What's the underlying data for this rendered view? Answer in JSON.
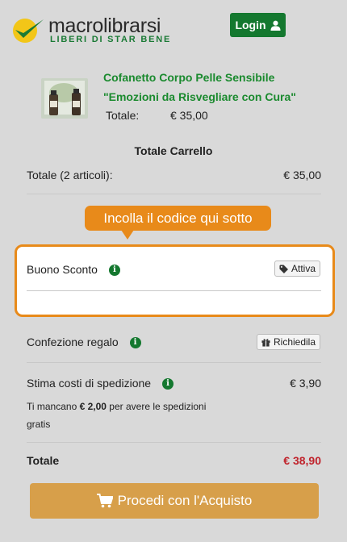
{
  "header": {
    "logo_name": "macrolibrarsi",
    "logo_tagline": "LIBERI DI STAR BENE",
    "login_label": "Login"
  },
  "product": {
    "title_line1": "Cofanetto Corpo Pelle Sensibile",
    "title_line2": "\"Emozioni da Risvegliare con Cura\"",
    "total_label": "Totale:",
    "total_value": "€ 35,00"
  },
  "cart": {
    "title": "Totale Carrello",
    "subtotal_label": "Totale (2 articoli):",
    "subtotal_value": "€ 35,00"
  },
  "coupon": {
    "tooltip": "Incolla il codice qui sotto",
    "label": "Buono Sconto",
    "button_label": "Attiva"
  },
  "gift": {
    "label": "Confezione regalo",
    "button_label": "Richiedila"
  },
  "shipping": {
    "label": "Stima costi di spedizione",
    "value": "€ 3,90",
    "note_prefix": "Ti mancano ",
    "note_amount": "€ 2,00",
    "note_suffix": " per avere le spedizioni gratis"
  },
  "total": {
    "label": "Totale",
    "value": "€ 38,90"
  },
  "checkout": {
    "label": "Procedi con l'Acquisto"
  },
  "colors": {
    "brand_green": "#14782f",
    "accent_orange": "#e88a1a",
    "total_red": "#c0232c",
    "checkout_bg": "#d79f4a"
  }
}
